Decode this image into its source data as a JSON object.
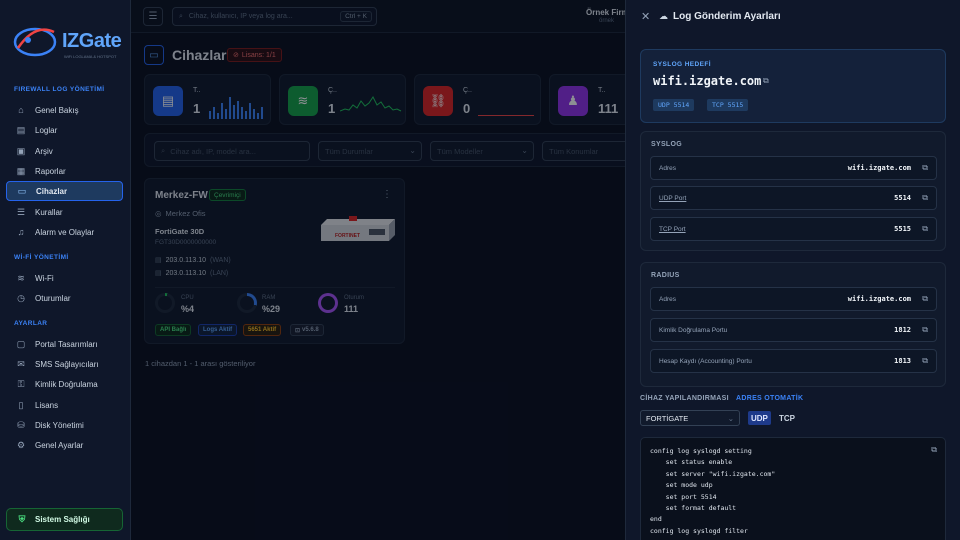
{
  "brand": {
    "name": "IZGate",
    "tagline": "WiFi LOGLAMA & HOTSPOT"
  },
  "sidebar": {
    "sections": [
      {
        "title": "FIREWALL LOG YÖNETİMİ"
      },
      {
        "title": "Wİ-Fİ YÖNETİMİ"
      },
      {
        "title": "AYARLAR"
      }
    ],
    "items": [
      {
        "label": "Genel Bakış",
        "icon": "home-icon"
      },
      {
        "label": "Loglar",
        "icon": "document-icon"
      },
      {
        "label": "Arşiv",
        "icon": "archive-icon"
      },
      {
        "label": "Raporlar",
        "icon": "report-icon"
      },
      {
        "label": "Cihazlar",
        "icon": "monitor-icon",
        "active": true
      },
      {
        "label": "Kurallar",
        "icon": "rules-icon"
      },
      {
        "label": "Alarm ve Olaylar",
        "icon": "bell-icon"
      },
      {
        "label": "Wi-Fi",
        "icon": "wifi-icon"
      },
      {
        "label": "Oturumlar",
        "icon": "clock-icon"
      },
      {
        "label": "Portal Tasarımları",
        "icon": "portal-icon"
      },
      {
        "label": "SMS Sağlayıcıları",
        "icon": "sms-icon"
      },
      {
        "label": "Kimlik Doğrulama",
        "icon": "key-icon"
      },
      {
        "label": "Lisans",
        "icon": "license-icon"
      },
      {
        "label": "Disk Yönetimi",
        "icon": "disk-icon"
      },
      {
        "label": "Genel Ayarlar",
        "icon": "gear-icon"
      }
    ],
    "health_label": "Sistem Sağlığı"
  },
  "topbar": {
    "search_placeholder": "Cihaz, kullanıcı, IP veya log ara...",
    "shortcut": "Ctrl + K",
    "user_name": "Örnek Firm",
    "user_sub": "örnek"
  },
  "page": {
    "title": "Cihazlar",
    "license_badge": "Lisans: 1/1"
  },
  "stats": [
    {
      "label": "T..",
      "value": "1",
      "color": "#3b82f6",
      "icon": "server-icon"
    },
    {
      "label": "Ç..",
      "value": "1",
      "color": "#22c55e",
      "icon": "wifi-icon"
    },
    {
      "label": "Ç..",
      "value": "0",
      "color": "#ef4444",
      "icon": "link-off-icon"
    },
    {
      "label": "T..",
      "value": "111",
      "color": "#a855f7",
      "icon": "users-icon"
    }
  ],
  "filters": {
    "search_placeholder": "Cihaz adı, IP, model ara...",
    "status": "Tüm Durumlar",
    "models": "Tüm Modeller",
    "locations": "Tüm Konumlar"
  },
  "device": {
    "name": "Merkez-FW",
    "status": "Çevrimiçi",
    "location": "Merkez Ofis",
    "model": "FortiGate 30D",
    "serial": "FGT30D0000000000",
    "wan_ip": "203.0.113.10",
    "wan_tag": "(WAN)",
    "lan_ip": "203.0.113.10",
    "lan_tag": "(LAN)",
    "brand_on_image": "FORTINET",
    "cpu_label": "CPU",
    "cpu_value": "%4",
    "cpu_pct": 4,
    "ram_label": "RAM",
    "ram_value": "%29",
    "ram_pct": 29,
    "session_label": "Oturum",
    "session_value": "111",
    "chips": [
      "API Bağlı",
      "Logs Aktif",
      "5651 Aktif",
      "v5.6.8"
    ]
  },
  "pagination": "1 cihazdan 1 - 1 arası gösteriliyor",
  "panel": {
    "title": "Log Gönderim Ayarları",
    "target": {
      "label": "SYSLOG HEDEFİ",
      "host": "wifi.izgate.com",
      "udp": "UDP 5514",
      "tcp": "TCP 5515"
    },
    "syslog": {
      "title": "SYSLOG",
      "rows": [
        {
          "label": "Adres",
          "value": "wifi.izgate.com"
        },
        {
          "label": "UDP Port",
          "value": "5514"
        },
        {
          "label": "TCP Port",
          "value": "5515"
        }
      ]
    },
    "radius": {
      "title": "RADIUS",
      "rows": [
        {
          "label": "Adres",
          "value": "wifi.izgate.com"
        },
        {
          "label": "Kimlik Doğrulama Portu",
          "value": "1812"
        },
        {
          "label": "Hesap Kaydı (Accounting) Portu",
          "value": "1813"
        }
      ]
    },
    "config": {
      "title": "CİHAZ YAPILANDIRMASI",
      "auto": "ADRES OTOMATİK",
      "vendor": "FORTİGATE",
      "udp": "UDP",
      "tcp": "TCP",
      "lines": [
        "config log syslogd setting",
        "    set status enable",
        "    set server \"wifi.izgate.com\"",
        "    set mode udp",
        "    set port 5514",
        "    set format default",
        "end",
        "config log syslogd filter"
      ]
    }
  }
}
